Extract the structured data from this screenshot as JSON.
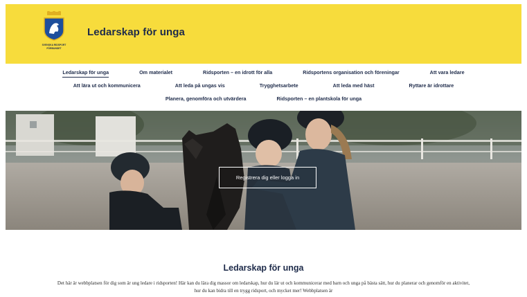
{
  "header": {
    "site_title": "Ledarskap för unga",
    "logo_text_line1": "SVENSKA RIDSPORT",
    "logo_text_line2": "FÖRBUNDET",
    "brand_color": "#f7dc3c",
    "text_color": "#1e2b4a"
  },
  "nav": {
    "row1": [
      "Ledarskap för unga",
      "Om materialet",
      "Ridsporten – en idrott för alla",
      "Ridsportens organisation och föreningar",
      "Att vara ledare"
    ],
    "row2": [
      "Att lära ut och kommunicera",
      "Att leda på ungas vis",
      "Trygghetsarbete",
      "Att leda med häst",
      "Ryttare är idrottare"
    ],
    "row3": [
      "Planera, genomföra och utvärdera",
      "Ridsporten – en plantskola för unga"
    ],
    "active_item": "Ledarskap för unga"
  },
  "hero": {
    "button_label": "Registrera dig eller logga in"
  },
  "content": {
    "title": "Ledarskap för unga",
    "body": "Det här är webbplatsen för dig som är ung ledare i ridsporten! Här kan du lära dig massor om ledarskap, hur du lär ut och kommunicerar med barn och unga på bästa sätt, hur du planerar och genomför en aktivitet, hur du kan bidra till en trygg ridsport, och mycket mer! Webbplatsen är"
  }
}
